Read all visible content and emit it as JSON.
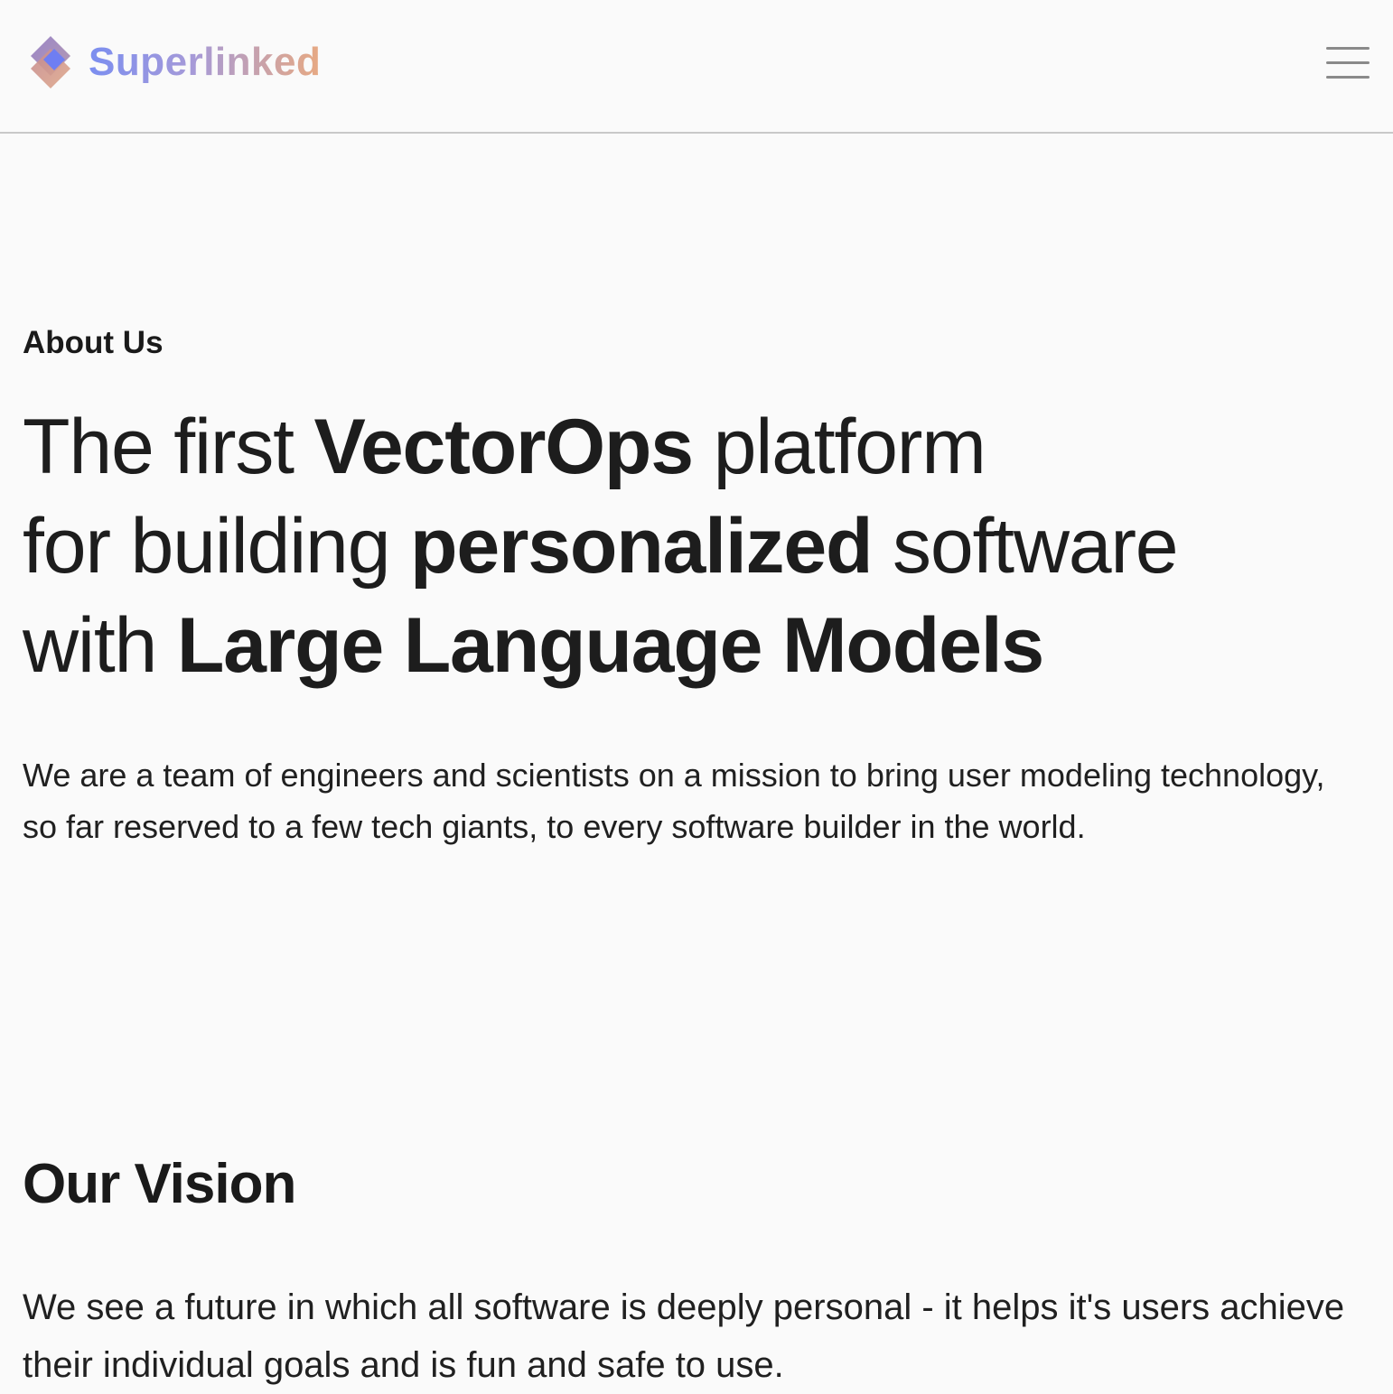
{
  "header": {
    "brand_name": "Superlinked",
    "menu_icon": "hamburger-menu-icon",
    "logo_icon": "superlinked-diamond-logo"
  },
  "about": {
    "eyebrow": "About Us",
    "headline": {
      "line1_a": "The first ",
      "line1_b": "VectorOps",
      "line1_c": " platform",
      "line2_a": "for building ",
      "line2_b": "personalized",
      "line2_c": " software",
      "line3_a": "with ",
      "line3_b": "Large Language Models"
    },
    "intro": "We are a team of engineers and scientists on a mission to bring user modeling technology, so far reserved to a few tech giants, to every software builder in the world."
  },
  "vision": {
    "title": "Our Vision",
    "text": "We see a future in which all software is deeply personal - it helps it's users achieve their individual goals and is fun and safe to use."
  },
  "colors": {
    "background": "#fafafa",
    "text": "#1f1f1f",
    "brand_gradient_start": "#7b8ef0",
    "brand_gradient_end": "#e7a982",
    "divider": "#c9c9c9"
  }
}
